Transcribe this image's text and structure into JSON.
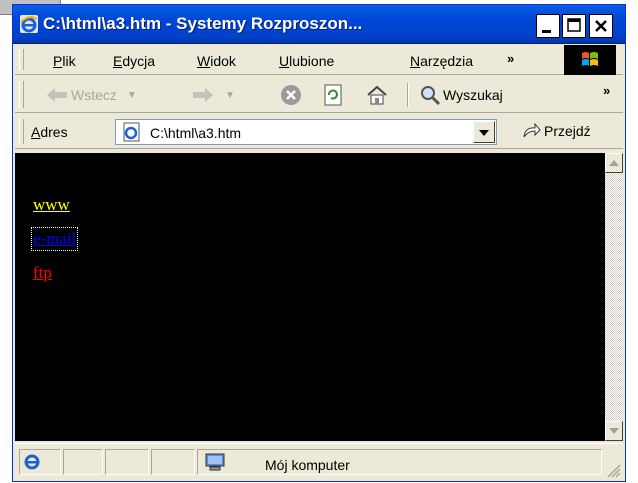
{
  "window": {
    "title": "C:\\html\\a3.htm - Systemy Rozproszon..."
  },
  "menubar": {
    "items": [
      {
        "key": "P",
        "rest": "lik"
      },
      {
        "key": "E",
        "rest": "dycja"
      },
      {
        "key": "W",
        "rest": "idok"
      },
      {
        "key": "U",
        "rest": "lubione"
      },
      {
        "key": "N",
        "rest": "arzędzia"
      }
    ],
    "overflow": "»"
  },
  "toolbar": {
    "back_label": "Wstecz",
    "search_label": "Wyszukaj",
    "overflow": "»"
  },
  "address": {
    "label_key": "A",
    "label_rest": "dres",
    "value": "C:\\html\\a3.htm",
    "go_label": "Przejdź"
  },
  "content": {
    "background": "#000000",
    "links": [
      {
        "text": "www",
        "color": "#ffff00"
      },
      {
        "text": "e-mail",
        "color": "#0000ff",
        "focused": true
      },
      {
        "text": "ftp",
        "color": "#ff0000"
      }
    ]
  },
  "statusbar": {
    "zone_label": "Mój komputer"
  },
  "icons": [
    "ie-logo-icon",
    "back-arrow-icon",
    "forward-arrow-icon",
    "stop-icon",
    "refresh-icon",
    "home-icon",
    "search-icon",
    "page-icon",
    "go-arrow-icon",
    "computer-icon",
    "resize-grip-icon",
    "windows-logo-icon"
  ]
}
